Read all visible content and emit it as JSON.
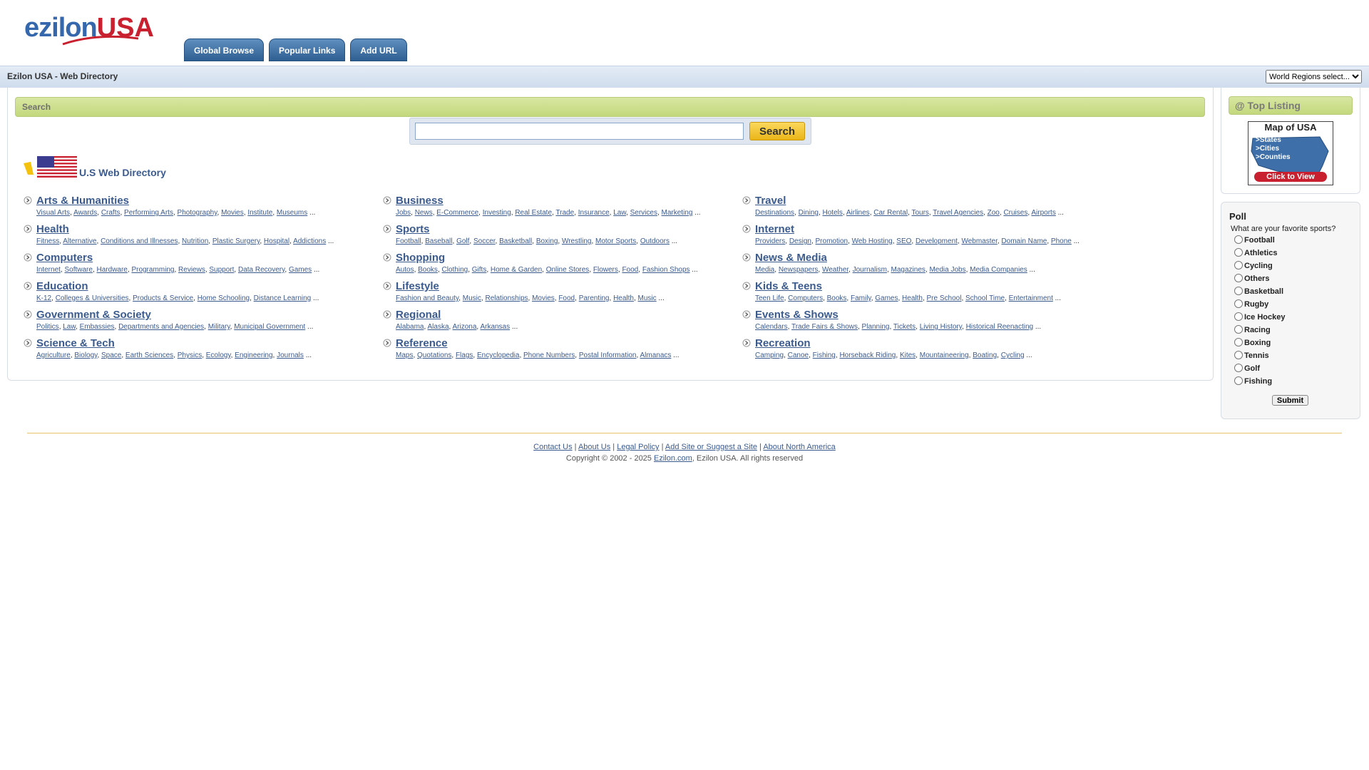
{
  "brand": {
    "part1": "ezil",
    "part2": "on",
    "part3": "USA"
  },
  "tabs": [
    "Global Browse",
    "Popular Links",
    "Add URL"
  ],
  "bar": {
    "title": "Ezilon USA - Web Directory",
    "region_select": "World Regions select..."
  },
  "search": {
    "heading": "Search",
    "button": "Search",
    "value": ""
  },
  "directory_title": "U.S Web Directory",
  "categories": [
    {
      "name": "Arts & Humanities",
      "subs": [
        "Visual Arts",
        "Awards",
        "Crafts",
        "Performing Arts",
        "Photography",
        "Movies",
        "Institute",
        "Museums"
      ]
    },
    {
      "name": "Business",
      "subs": [
        "Jobs",
        "News",
        "E-Commerce",
        "Investing",
        "Real Estate",
        "Trade",
        "Insurance",
        "Law",
        "Services",
        "Marketing"
      ]
    },
    {
      "name": "Travel",
      "subs": [
        "Destinations",
        "Dining",
        "Hotels",
        "Airlines",
        "Car Rental",
        "Tours",
        "Travel Agencies",
        "Zoo",
        "Cruises",
        "Airports"
      ]
    },
    {
      "name": "Health",
      "subs": [
        "Fitness",
        "Alternative",
        "Conditions and Illnesses",
        "Nutrition",
        "Plastic Surgery",
        "Hospital",
        "Addictions"
      ]
    },
    {
      "name": "Sports",
      "subs": [
        "Football",
        "Baseball",
        "Golf",
        "Soccer",
        "Basketball",
        "Boxing",
        "Wrestling",
        "Motor Sports",
        "Outdoors"
      ]
    },
    {
      "name": "Internet",
      "subs": [
        "Providers",
        "Design",
        "Promotion",
        "Web Hosting",
        "SEO",
        "Development",
        "Webmaster",
        "Domain Name",
        "Phone"
      ]
    },
    {
      "name": "Computers",
      "subs": [
        "Internet",
        "Software",
        "Hardware",
        "Programming",
        "Reviews",
        "Support",
        "Data Recovery",
        "Games"
      ]
    },
    {
      "name": "Shopping",
      "subs": [
        "Autos",
        "Books",
        "Clothing",
        "Gifts",
        "Home & Garden",
        "Online Stores",
        "Flowers",
        "Food",
        "Fashion Shops"
      ]
    },
    {
      "name": "News & Media",
      "subs": [
        "Media",
        "Newspapers",
        "Weather",
        "Journalism",
        "Magazines",
        "Media Jobs",
        "Media Companies"
      ]
    },
    {
      "name": "Education",
      "subs": [
        "K-12",
        "Colleges & Universities",
        "Products & Service",
        "Home Schooling",
        "Distance Learning"
      ]
    },
    {
      "name": "Lifestyle",
      "subs": [
        "Fashion and Beauty",
        "Music",
        "Relationships",
        "Movies",
        "Food",
        "Parenting",
        "Health",
        "Music"
      ]
    },
    {
      "name": "Kids & Teens",
      "subs": [
        "Teen Life",
        "Computers",
        "Books",
        "Family",
        "Games",
        "Health",
        "Pre School",
        "School Time",
        "Entertainment"
      ]
    },
    {
      "name": "Government & Society",
      "subs": [
        "Politics",
        "Law",
        "Embassies",
        "Departments and Agencies",
        "Military",
        "Municipal Government"
      ]
    },
    {
      "name": "Regional",
      "subs": [
        "Alabama",
        "Alaska",
        "Arizona",
        "Arkansas"
      ]
    },
    {
      "name": "Events & Shows",
      "subs": [
        "Calendars",
        "Trade Fairs & Shows",
        "Planning",
        "Tickets",
        "Living History",
        "Historical Reenacting"
      ]
    },
    {
      "name": "Science & Tech",
      "subs": [
        "Agriculture",
        "Biology",
        "Space",
        "Earth Sciences",
        "Physics",
        "Ecology",
        "Engineering",
        "Journals"
      ]
    },
    {
      "name": "Reference",
      "subs": [
        "Maps",
        "Quotations",
        "Flags",
        "Encyclopedia",
        "Phone Numbers",
        "Postal Information",
        "Almanacs"
      ]
    },
    {
      "name": "Recreation",
      "subs": [
        "Camping",
        "Canoe",
        "Fishing",
        "Horseback Riding",
        "Kites",
        "Mountaineering",
        "Boating",
        "Cycling"
      ]
    }
  ],
  "top_listing": {
    "heading": "@ Top Listing",
    "map_title": "Map of USA",
    "map_lines": [
      ">States",
      ">Cities",
      ">Counties"
    ],
    "map_button": "Click to View"
  },
  "poll": {
    "title": "Poll",
    "question": "What are your favorite sports?",
    "options": [
      "Football",
      "Athletics",
      "Cycling",
      "Others",
      "Basketball",
      "Rugby",
      "Ice Hockey",
      "Racing",
      "Boxing",
      "Tennis",
      "Golf",
      "Fishing"
    ],
    "submit": "Submit"
  },
  "footer": {
    "links": [
      "Contact Us",
      "About Us",
      "Legal Policy",
      "Add Site or Suggest a Site",
      "About North America"
    ],
    "copyright_prefix": "Copyright © 2002 - 2025 ",
    "copyright_link": "Ezilon.com",
    "copyright_suffix": ", Ezilon USA. All rights reserved"
  },
  "colors": {
    "link": "#3b5b8f",
    "accent_red": "#c8202e",
    "tab_blue": "#2f5f92",
    "green_header": "#c3d87c",
    "search_button": "#eab519"
  }
}
